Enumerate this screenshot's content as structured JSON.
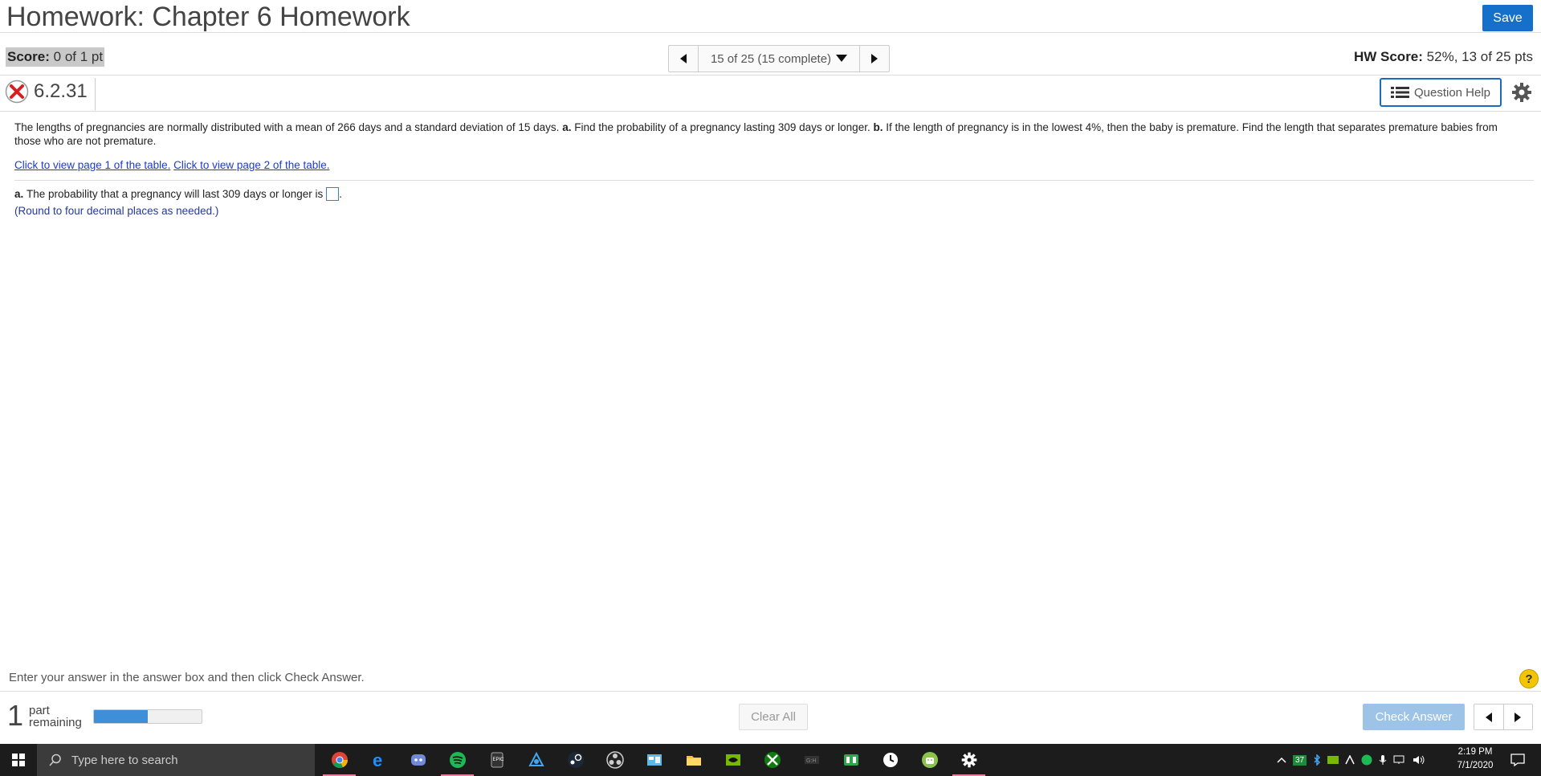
{
  "header": {
    "title": "Homework: Chapter 6 Homework",
    "save_label": "Save"
  },
  "score_bar": {
    "score_label": "Score:",
    "score_value": "0 of 1 pt",
    "nav_text": "15 of 25 (15 complete)",
    "hw_score_label": "HW Score:",
    "hw_score_value": "52%, 13 of 25 pts"
  },
  "question": {
    "id": "6.2.31",
    "status_icon": "incorrect-x-icon",
    "help_label": "Question Help",
    "text_intro": "The lengths of pregnancies are normally distributed with a mean of 266 days and a standard deviation of 15 days.",
    "a_marker": "a.",
    "a_text": "Find the probability of a pregnancy lasting 309 days or longer.",
    "b_marker": "b.",
    "b_text": "If the length of pregnancy is in the lowest 4%, then the baby is premature. Find the length that separates premature babies from those who are not premature.",
    "link1": "Click to view page 1 of the table.",
    "link2": "Click to view page 2 of the table.",
    "part_a_marker": "a.",
    "part_a_text": "The probability that a pregnancy will last 309 days or longer is",
    "part_a_answer": "",
    "round_note": "(Round to four decimal places as needed.)"
  },
  "footer": {
    "instruction": "Enter your answer in the answer box and then click Check Answer.",
    "part_count": "1",
    "part_label_1": "part",
    "part_label_2": "remaining",
    "progress_fraction": 0.5,
    "clear_label": "Clear All",
    "check_label": "Check Answer"
  },
  "taskbar": {
    "search_placeholder": "Type here to search",
    "time": "2:19 PM",
    "date": "7/1/2020",
    "tray_badge": "37",
    "icons": [
      "chrome-icon",
      "edge-icon",
      "discord-icon",
      "spotify-icon",
      "epic-games-icon",
      "app-icon",
      "steam-icon",
      "obs-icon",
      "control-panel-icon",
      "file-explorer-icon",
      "nvidia-icon",
      "xbox-icon",
      "game-icon",
      "app-green-icon",
      "clock-app-icon",
      "android-icon",
      "settings-icon"
    ]
  },
  "colors": {
    "save_blue": "#1470c8",
    "link_blue": "#1a3bd8",
    "note_blue": "#243a9b",
    "check_disabled": "#9dc3e6",
    "progress_fill": "#3f8fd8",
    "incorrect_red": "#d62020"
  }
}
